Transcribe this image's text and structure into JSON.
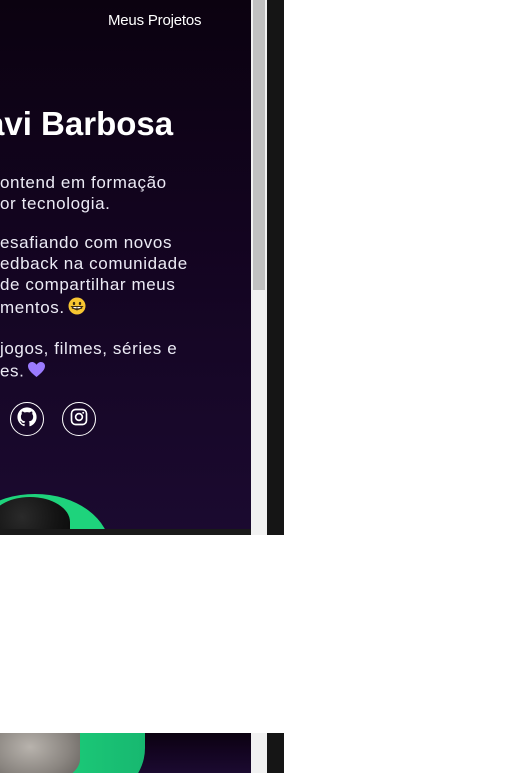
{
  "nav": {
    "projects_label": "Meus Projetos"
  },
  "hero": {
    "name": "avi Barbosa",
    "bio_lines": [
      "ontend em formação",
      "or tecnologia.",
      "esafiando com novos",
      "edback na comunidade",
      " de compartilhar meus",
      "mentos.",
      " jogos, filmes, séries e",
      "es."
    ]
  },
  "social": [
    {
      "icon": "github-icon"
    },
    {
      "icon": "instagram-icon"
    }
  ],
  "colors": {
    "background_top": "#0b0210",
    "background_bottom": "#1b0a30",
    "accent_green": "#1ed37c",
    "heart_purple": "#9b7bff",
    "text": "#ffffff"
  }
}
